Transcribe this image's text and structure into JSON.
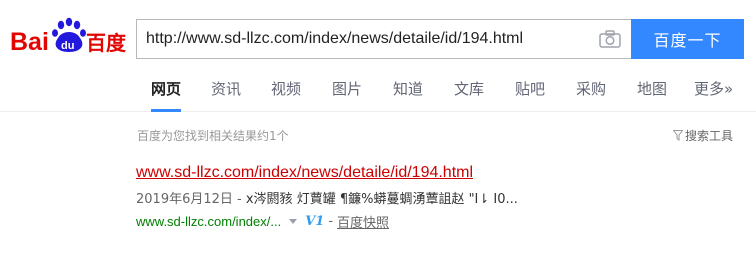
{
  "header": {
    "logo_text": "Bai百度",
    "search_query": "http://www.sd-llzc.com/index/news/detaile/id/194.html",
    "search_button_label": "百度一下"
  },
  "tabs": [
    {
      "label": "网页",
      "active": true
    },
    {
      "label": "资讯"
    },
    {
      "label": "视频"
    },
    {
      "label": "图片"
    },
    {
      "label": "知道"
    },
    {
      "label": "文库"
    },
    {
      "label": "贴吧"
    },
    {
      "label": "采购"
    },
    {
      "label": "地图"
    },
    {
      "label": "更多"
    }
  ],
  "result_stats": "百度为您找到相关结果约1个",
  "search_tools_label": "搜索工具",
  "results": [
    {
      "title": "www.sd-llzc.com/index/news/detaile/id/194.html",
      "date": "2019年6月12日 -",
      "abstract": " x涔閼豥 灯蕒罐 ¶鐮%蟒蔓蜩湧蕈詛赵 \"I⇂ I0...",
      "display_url": "www.sd-llzc.com/index/...",
      "badge": "V1",
      "separator": "-",
      "snapshot_label": "百度快照"
    }
  ],
  "colors": {
    "accent": "#3388ff",
    "logo_red": "#e10602",
    "logo_blue": "#2319dc",
    "title_red": "#cc0000",
    "url_green": "#008000"
  }
}
